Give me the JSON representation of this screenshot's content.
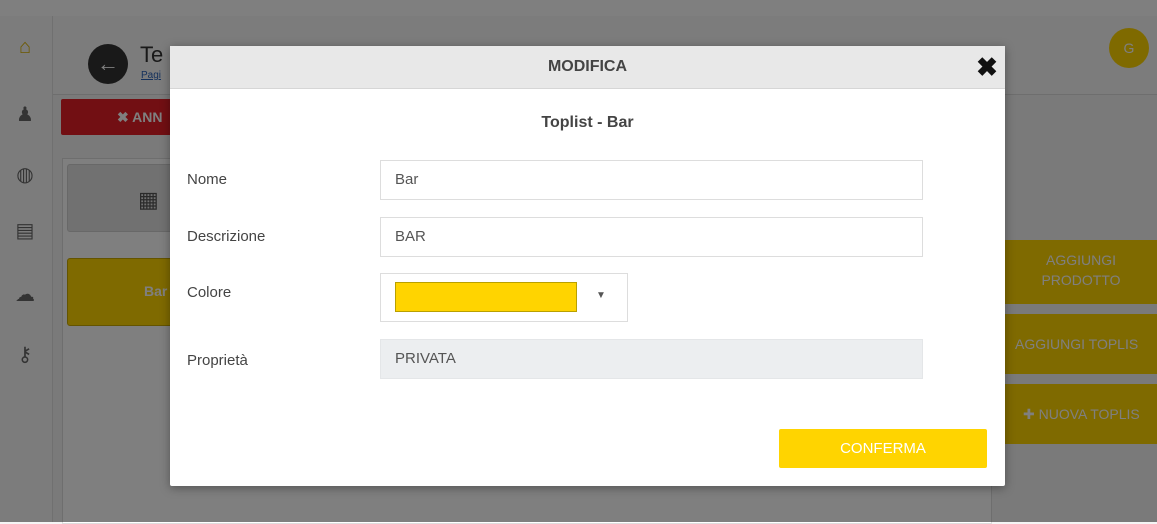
{
  "app": {
    "title": "Te",
    "subtitle_link": "Pagi",
    "avatar_initial": "G",
    "annulla_label": "✖ ANN",
    "tiles": {
      "bar_label": "Bar"
    },
    "right_buttons": [
      "AGGIUNGI PRODOTTO",
      "AGGIUNGI TOPLIS",
      "✚ NUOVA TOPLIS"
    ]
  },
  "modal": {
    "title": "MODIFICA",
    "subtitle": "Toplist - Bar",
    "fields": {
      "nome_label": "Nome",
      "nome_value": "Bar",
      "descrizione_label": "Descrizione",
      "descrizione_value": "BAR",
      "colore_label": "Colore",
      "colore_value": "#ffd400",
      "proprieta_label": "Proprietà",
      "proprieta_value": "PRIVATA"
    },
    "confirm_label": "CONFERMA"
  },
  "icons": {
    "back": "arrow-left-icon",
    "close": "close-icon",
    "caret": "caret-down-icon",
    "grid": "grid-icon"
  },
  "colors": {
    "accent": "#ffd400",
    "danger": "#e41e26"
  }
}
